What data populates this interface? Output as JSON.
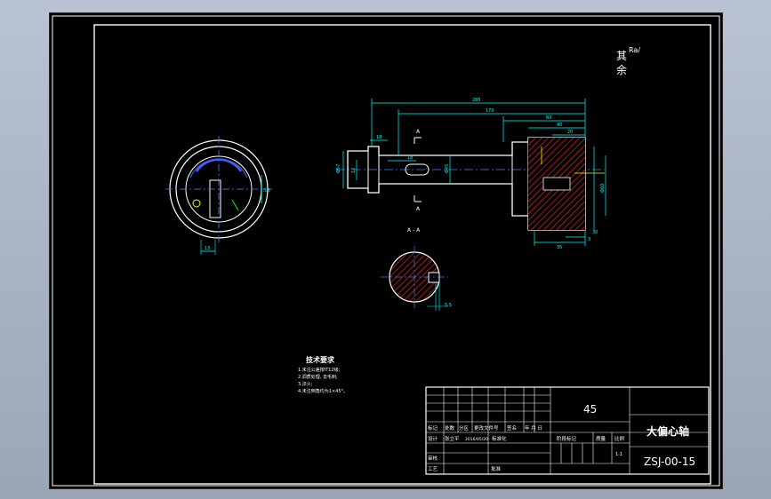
{
  "drawing": {
    "surface_note_line1": "其",
    "surface_note_line2": "余",
    "roughness_symbol": "Ra/",
    "section_label_top": "A",
    "section_label_bottom": "A",
    "section_view_title": "A - A",
    "dimensions": {
      "overall_length": "285",
      "length_2": "170",
      "length_3": "60",
      "length_4": "40",
      "length_5": "20",
      "length_6": "18",
      "length_7": "30",
      "length_8": "35",
      "length_9": "3",
      "diameter_left": "Φ57",
      "diameter_mid": "Φ45",
      "diameter_right": "Φ60",
      "small_1": "18",
      "small_2": "12",
      "section_dim": "5.5",
      "left_view_dim": "5.5",
      "left_view_bottom": "13"
    }
  },
  "technical_requirements": {
    "title": "技术要求",
    "items": [
      "1.未注公差按IT12级;",
      "2.调质处理, 去毛刺;",
      "3.淬火;",
      "4.未注倒角均为1×45°。"
    ]
  },
  "title_block": {
    "material": "45",
    "part_name": "大偏心轴",
    "drawing_number": "ZSJ-00-15",
    "header_cells": [
      "标记",
      "处数",
      "分区",
      "更改文件号",
      "签名",
      "年 月 日"
    ],
    "row_design": [
      "设计",
      "张立平",
      "2016/05/20",
      "标准化"
    ],
    "stage_label": "阶段标记",
    "weight_label": "质量",
    "scale_label": "比例",
    "scale_value": "1:1",
    "review_label": "审核",
    "process_label": "工艺",
    "approve_label": "批准"
  },
  "colors": {
    "background": "#000000",
    "outline": "#ffffff",
    "dimension": "#00ffff",
    "centerline": "#4d7cff",
    "hatch": "#ff2a2a",
    "feature": "#00ff00",
    "highlight": "#ffff00"
  }
}
